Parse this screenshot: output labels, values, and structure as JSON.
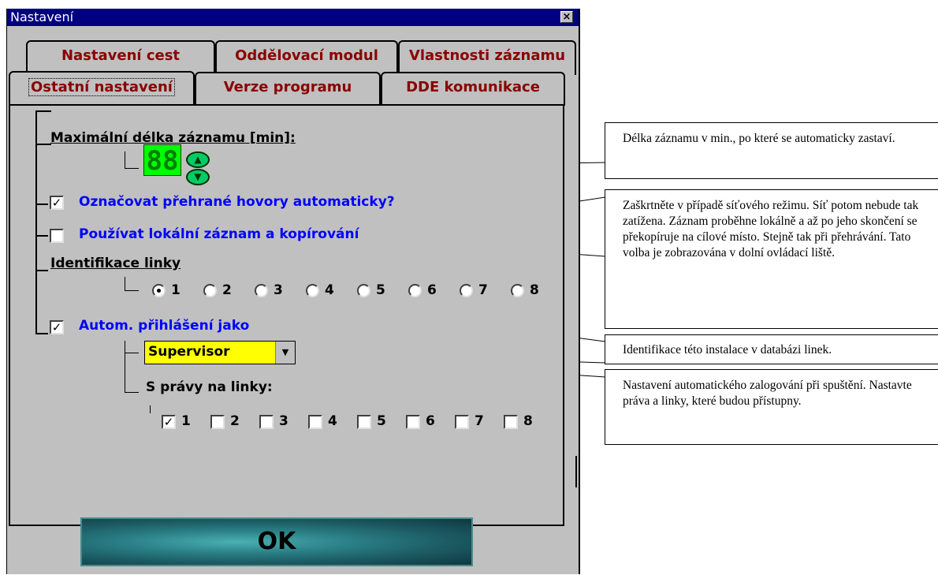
{
  "window": {
    "title": "Nastavení",
    "close_label": "×"
  },
  "tabs_back": [
    "Nastavení cest",
    "Oddělovací modul",
    "Vlastnosti záznamu"
  ],
  "tabs_front": [
    "Ostatní nastavení",
    "Verze programu",
    "DDE komunikace"
  ],
  "settings": {
    "max_length_label": "Maximální délka záznamu [min]:",
    "max_length_value": "88",
    "mark_played_label": "Označovat přehrané hovory automaticky?",
    "mark_played_checked": true,
    "local_record_label": "Používat lokální záznam a kopírování",
    "local_record_checked": false,
    "line_id_label": "Identifikace linky",
    "line_radios": [
      "1",
      "2",
      "3",
      "4",
      "5",
      "6",
      "7",
      "8"
    ],
    "line_selected": "1",
    "auto_login_label": "Autom. přihlášení jako",
    "auto_login_checked": true,
    "user_value": "Supervisor",
    "rights_label": "S právy na linky:",
    "rights_checks": [
      "1",
      "2",
      "3",
      "4",
      "5",
      "6",
      "7",
      "8"
    ],
    "rights_checked": [
      "1"
    ],
    "check_mark": "✓"
  },
  "ok_label": "OK",
  "callouts": {
    "max_length": "Délka záznamu v min., po které se automaticky zastaví.",
    "network": "Zaškrtněte v případě síťového režimu. Síť potom nebude tak zatížena. Záznam proběhne lokálně a až po jeho skončení se překopíruje na cílové místo. Stejně tak při přehrávání. Tato volba je zobrazována v dolní ovládací liště.",
    "line_id": "Identifikace této instalace v databázi linek.",
    "auto_login": "Nastavení automatického zalogování při spuštění. Nastavte práva a linky, které budou přístupny."
  }
}
